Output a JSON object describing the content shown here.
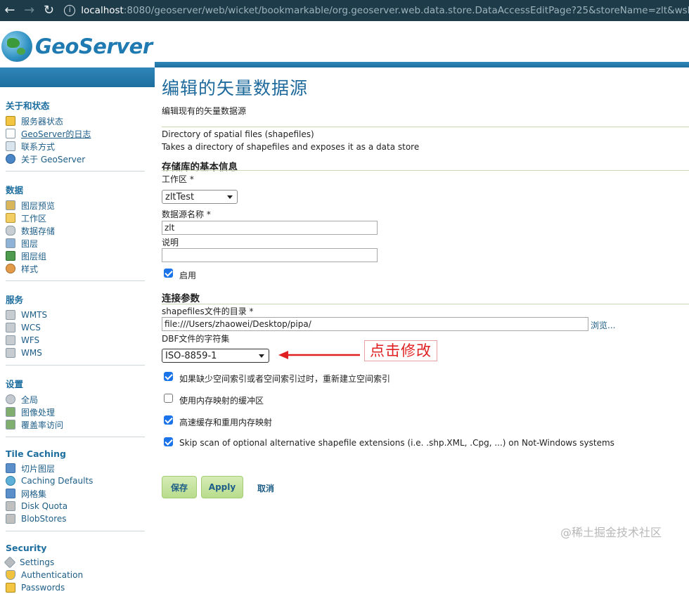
{
  "browser": {
    "url_host": "localhost",
    "url_path": ":8080/geoserver/web/wicket/bookmarkable/org.geoserver.web.data.store.DataAccessEditPage?25&storeName=zlt&wsN"
  },
  "header": {
    "logo_text": "GeoServer"
  },
  "sidebar": {
    "sections": [
      {
        "title": "关于和状态",
        "items": [
          {
            "label": "服务器状态",
            "icon": "warning-icon"
          },
          {
            "label": "GeoServer的日志",
            "icon": "document-icon"
          },
          {
            "label": "联系方式",
            "icon": "contact-card-icon"
          },
          {
            "label": "关于 GeoServer",
            "icon": "info-icon"
          }
        ]
      },
      {
        "title": "数据",
        "items": [
          {
            "label": "图层预览",
            "icon": "preview-icon"
          },
          {
            "label": "工作区",
            "icon": "folder-icon"
          },
          {
            "label": "数据存储",
            "icon": "database-icon"
          },
          {
            "label": "图层",
            "icon": "layer-icon"
          },
          {
            "label": "图层组",
            "icon": "layer-group-icon"
          },
          {
            "label": "样式",
            "icon": "palette-icon"
          }
        ]
      },
      {
        "title": "服务",
        "items": [
          {
            "label": "WMTS",
            "icon": "service-icon"
          },
          {
            "label": "WCS",
            "icon": "service-icon"
          },
          {
            "label": "WFS",
            "icon": "service-icon"
          },
          {
            "label": "WMS",
            "icon": "service-icon"
          }
        ]
      },
      {
        "title": "设置",
        "items": [
          {
            "label": "全局",
            "icon": "gear-icon"
          },
          {
            "label": "图像处理",
            "icon": "image-icon"
          },
          {
            "label": "覆盖率访问",
            "icon": "image-icon"
          }
        ]
      },
      {
        "title": "Tile Caching",
        "items": [
          {
            "label": "切片图层",
            "icon": "tile-icon"
          },
          {
            "label": "Caching Defaults",
            "icon": "globe-icon"
          },
          {
            "label": "网格集",
            "icon": "grid-icon"
          },
          {
            "label": "Disk Quota",
            "icon": "disk-icon"
          },
          {
            "label": "BlobStores",
            "icon": "disk-icon"
          }
        ]
      },
      {
        "title": "Security",
        "items": [
          {
            "label": "Settings",
            "icon": "wrench-icon"
          },
          {
            "label": "Authentication",
            "icon": "shield-icon"
          },
          {
            "label": "Passwords",
            "icon": "key-icon"
          }
        ]
      }
    ]
  },
  "main": {
    "title": "编辑的矢量数据源",
    "description": "编辑现有的矢量数据源",
    "store_type": "Directory of spatial files (shapefiles)",
    "store_type_desc": "Takes a directory of shapefiles and exposes it as a data store",
    "basic_info_heading": "存储库的基本信息",
    "workspace_label": "工作区 *",
    "workspace_value": "zltTest",
    "name_label": "数据源名称 *",
    "name_value": "zlt",
    "description_label": "说明",
    "description_value": "",
    "enabled_label": "启用",
    "connection_heading": "连接参数",
    "shapefile_dir_label": "shapefiles文件的目录 *",
    "shapefile_dir_value": "file:///Users/zhaowei/Desktop/pipa/",
    "browse_label": "浏览...",
    "charset_label": "DBF文件的字符集",
    "charset_value": "ISO-8859-1",
    "annotation": "点击修改",
    "options": [
      {
        "label": "如果缺少空间索引或者空间索引过时，重新建立空间索引",
        "checked": true
      },
      {
        "label": "使用内存映射的缓冲区",
        "checked": false
      },
      {
        "label": "高速缓存和重用内存映射",
        "checked": true
      },
      {
        "label": "Skip scan of optional alternative shapefile extensions (i.e. .shp.XML, .Cpg, ...) on Not-Windows systems",
        "checked": true
      }
    ],
    "save_label": "保存",
    "apply_label": "Apply",
    "cancel_label": "取消"
  },
  "watermark": "@稀土掘金技术社区",
  "colors": {
    "brand_blue": "#1e6a9c",
    "browser_bar": "#1d3b49",
    "button_green": "#b8dc8c",
    "annotation_red": "#e02020"
  }
}
